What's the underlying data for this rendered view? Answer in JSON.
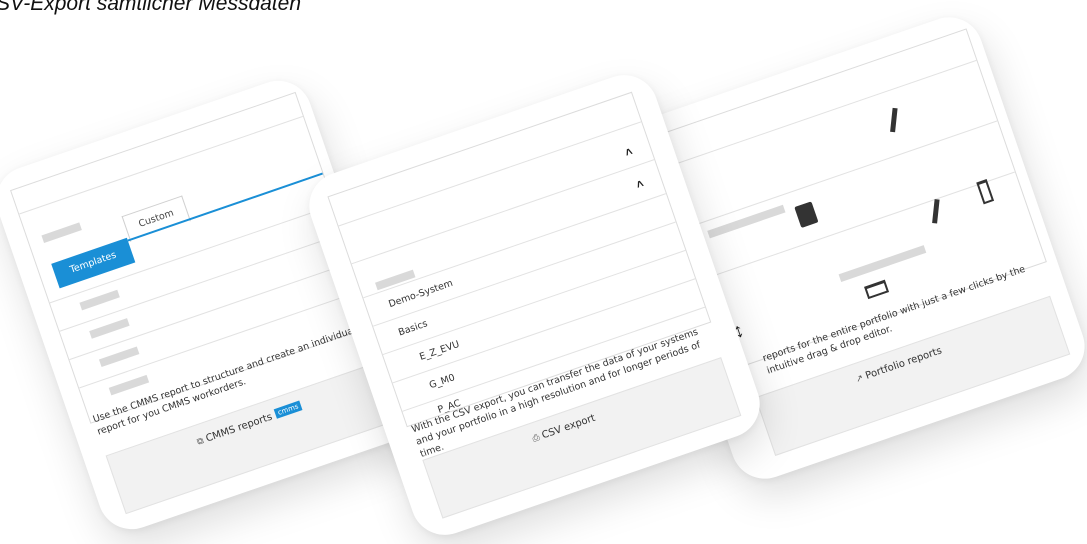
{
  "heading": "SV-Export sämtlicher Messdaten",
  "cards": {
    "cmms": {
      "tabs": [
        "Templates",
        "Custom"
      ],
      "description": "Use the CMMS report to structure and create an individual report for you CMMS workorders.",
      "button_label": "CMMS reports",
      "badge": "cmms",
      "accent_color": "#1a8fd6"
    },
    "csv": {
      "list_items": [
        "Demo-System",
        "Basics",
        "E_Z_EVU",
        "G_M0",
        "P_AC"
      ],
      "description": "With the CSV export, you can transfer the data of your systems and your portfolio in a high resolution and for longer periods of time.",
      "button_label": "CSV export"
    },
    "portfolio": {
      "description": "reports for the entire portfolio with just a few clicks by the intuitive drag & drop editor.",
      "button_label": "Portfolio reports"
    }
  },
  "icons": [
    "file-stack-icon",
    "file-csv-icon",
    "chart-icon",
    "pencil-icon",
    "document-chart-icon",
    "vertical-resize-icon",
    "chevron-up-icon",
    "table-icon",
    "trash-icon"
  ]
}
